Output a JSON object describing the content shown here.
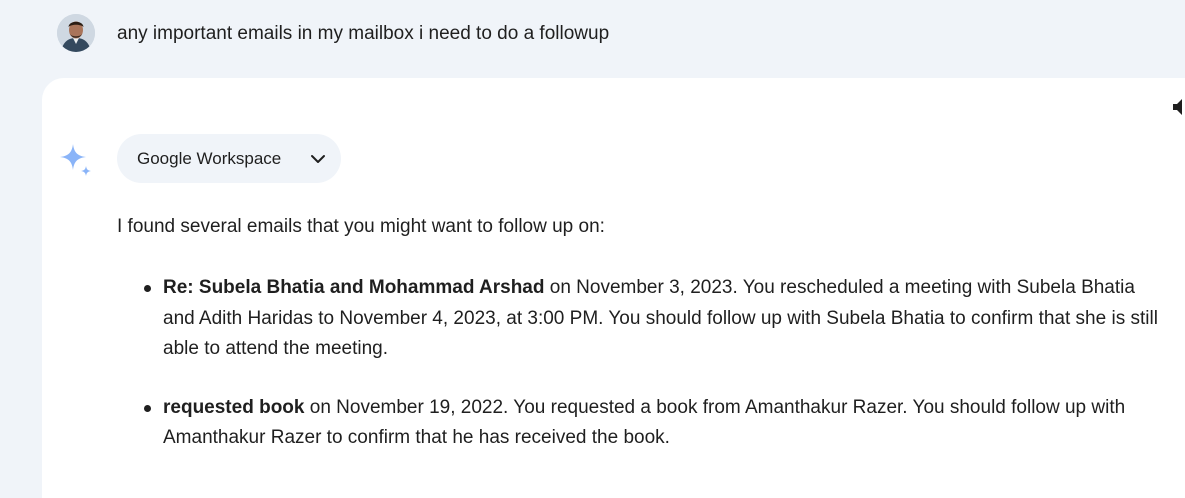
{
  "user_prompt": {
    "text": "any important emails in my mailbox i need to do a followup"
  },
  "response": {
    "chip": {
      "label": "Google Workspace",
      "icon": "chevron-down-icon"
    },
    "intro": "I found several emails that you might want to follow up on:",
    "emails": [
      {
        "subject": "Re: Subela Bhatia and Mohammad Arshad",
        "detail": " on November 3, 2023. You rescheduled a meeting with Subela Bhatia and Adith Haridas to November 4, 2023, at 3:00 PM. You should follow up with Subela Bhatia to confirm that she is still able to attend the meeting."
      },
      {
        "subject": "requested book",
        "detail": " on November 19, 2022. You requested a book from Amanthakur Razer. You should follow up with Amanthakur Razer to confirm that he has received the book."
      }
    ]
  },
  "colors": {
    "page_background": "#f0f4f9",
    "card_background": "#ffffff",
    "chip_background": "#f0f4f9",
    "sparkle": "#8ab4f8",
    "text": "#1f1f1f"
  }
}
